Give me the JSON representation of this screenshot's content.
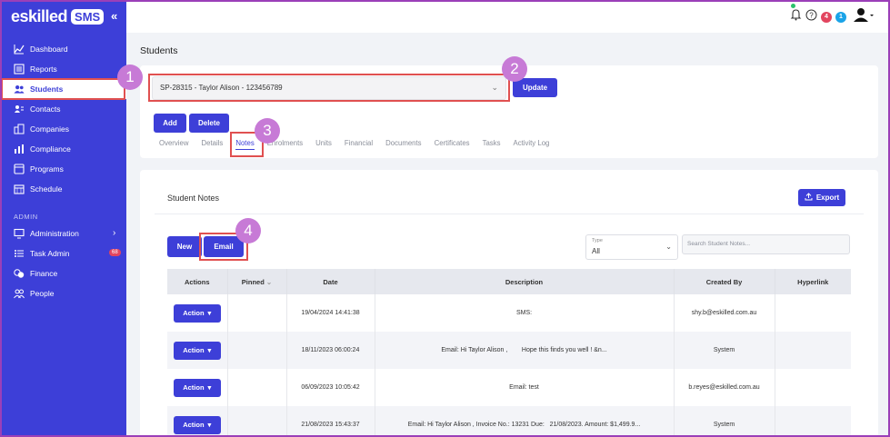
{
  "brand": {
    "logo_text": "eskilled",
    "logo_badge": "SMS",
    "collapse": "«"
  },
  "sidebar": {
    "items": [
      {
        "label": "Dashboard"
      },
      {
        "label": "Reports"
      },
      {
        "label": "Students"
      },
      {
        "label": "Contacts"
      },
      {
        "label": "Companies"
      },
      {
        "label": "Compliance"
      },
      {
        "label": "Programs"
      },
      {
        "label": "Schedule"
      }
    ],
    "admin_label": "ADMIN",
    "admin_items": [
      {
        "label": "Administration"
      },
      {
        "label": "Task Admin",
        "badge": "68"
      },
      {
        "label": "Finance"
      },
      {
        "label": "People"
      }
    ]
  },
  "topbar": {
    "badge_red": "4",
    "badge_blue": "1"
  },
  "page": {
    "title": "Students"
  },
  "student_select": {
    "value": "SP-28315 - Taylor Alison - 123456789"
  },
  "buttons": {
    "update": "Update",
    "add": "Add",
    "delete": "Delete",
    "new": "New",
    "email": "Email",
    "export": "Export"
  },
  "tabs": [
    "Overview",
    "Details",
    "Notes",
    "Enrolments",
    "Units",
    "Financial",
    "Documents",
    "Certificates",
    "Tasks",
    "Activity Log"
  ],
  "notes": {
    "title": "Student Notes",
    "type_label": "Type",
    "type_value": "All",
    "search_placeholder": "Search Student Notes...",
    "columns": [
      "Actions",
      "Pinned",
      "Date",
      "Description",
      "Created By",
      "Hyperlink"
    ],
    "rows": [
      {
        "action": "Action",
        "date": "19/04/2024 14:41:38",
        "description": "SMS:",
        "created_by": "shy.b@eskilled.com.au"
      },
      {
        "action": "Action",
        "date": "18/11/2023 06:00:24",
        "description": "Email: Hi Taylor Alison ,        Hope this finds you well ! &n...",
        "created_by": "System"
      },
      {
        "action": "Action",
        "date": "06/09/2023 10:05:42",
        "description": "Email: test",
        "created_by": "b.reyes@eskilled.com.au"
      },
      {
        "action": "Action",
        "date": "21/08/2023 15:43:37",
        "description": "Email: Hi Taylor Alison , Invoice No.: 13231 Due:   21/08/2023. Amount: $1,499.9...",
        "created_by": "System"
      }
    ]
  },
  "callouts": [
    "1",
    "2",
    "3",
    "4"
  ],
  "colors": {
    "primary": "#3d3fd8",
    "highlight": "#e05050",
    "callout": "#c77ad6"
  }
}
